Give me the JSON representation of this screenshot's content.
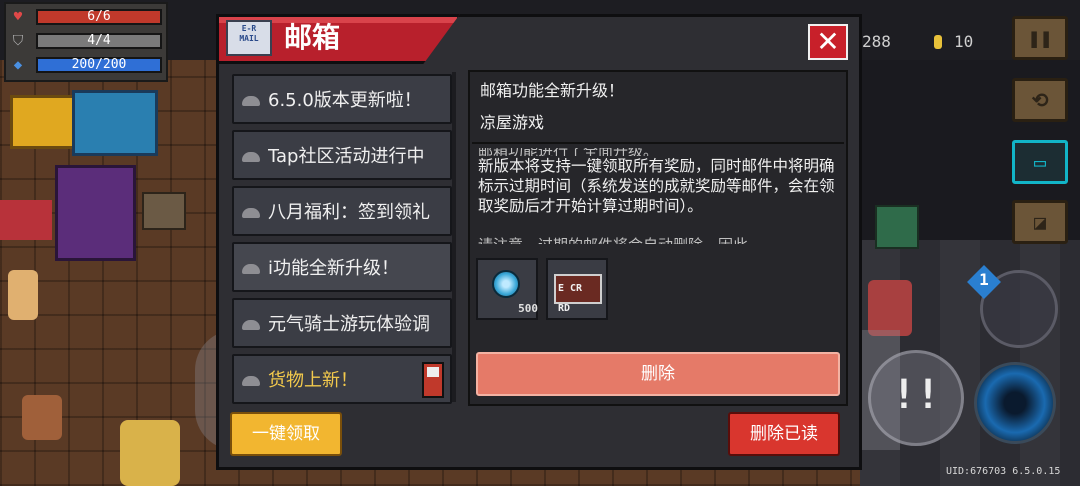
{
  "hud": {
    "hp": "6/6",
    "armor": "4/4",
    "energy": "200/200",
    "gems": "288",
    "coins": "10",
    "colors": {
      "hp": "#c0392b",
      "armor": "#7a7a7a",
      "energy": "#2f6fd6"
    }
  },
  "dialog": {
    "title": "邮箱",
    "mail_icon_text": "E-R MAIL",
    "close_glyph": "✕"
  },
  "mail_list": [
    {
      "label": "6.5.0版本更新啦！",
      "accent": false
    },
    {
      "label": "Tap社区活动进行中",
      "accent": false
    },
    {
      "label": "八月福利：签到领礼",
      "accent": false
    },
    {
      "label": "i功能全新升级！",
      "accent": false
    },
    {
      "label": "元气骑士游玩体验调",
      "accent": false
    },
    {
      "label": "货物上新！",
      "accent": true
    }
  ],
  "selected_mail": {
    "title": "邮箱功能全新升级！",
    "sender": "凉屋游戏",
    "body_cut_top": "邮箱功能进行了全面升级。",
    "body": "新版本将支持一键领取所有奖励，同时邮件中将明确标示过期时间（系统发送的成就奖励等邮件，会在领取奖励后才开始计算过期时间）。",
    "body_cut_bottom": "请注意，过期的邮件将会自动删除，因此",
    "rewards": [
      {
        "icon": "gem-icon",
        "count": "500"
      },
      {
        "icon": "card-icon",
        "label": "E CR RD"
      }
    ]
  },
  "buttons": {
    "delete": "删除",
    "claim_all": "一键领取",
    "delete_read": "删除已读"
  },
  "footer": {
    "uid": "UID:676703 6.5.0.15"
  }
}
